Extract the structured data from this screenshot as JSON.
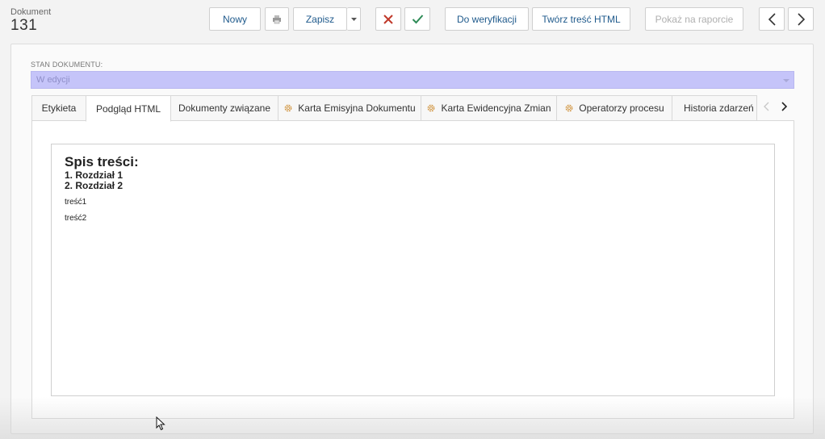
{
  "header": {
    "doc_label": "Dokument",
    "doc_number": "131"
  },
  "toolbar": {
    "new_label": "Nowy",
    "save_label": "Zapisz",
    "verify_label": "Do weryfikacji",
    "create_html_label": "Twórz treść HTML",
    "show_report_label": "Pokaż na raporcie"
  },
  "icons": {
    "print": "print-icon",
    "dropdown": "caret-down-icon",
    "cancel": "x-icon",
    "confirm": "check-icon",
    "prev": "chevron-left-icon",
    "next": "chevron-right-icon",
    "gear": "gear-icon"
  },
  "colors": {
    "cancel": "#c0392b",
    "confirm": "#2e8b57",
    "link": "#1f5a8c",
    "state_bg": "#c5c4f9",
    "gear": "#d39a4a"
  },
  "state": {
    "label": "STAN DOKUMENTU:",
    "value": "W edycji"
  },
  "tabs": [
    {
      "label": "Etykieta"
    },
    {
      "label": "Podgląd HTML",
      "active": true
    },
    {
      "label": "Dokumenty związane"
    },
    {
      "label": "Karta Emisyjna Dokumentu",
      "icon": "gear-icon"
    },
    {
      "label": "Karta Ewidencyjna Zmian",
      "icon": "gear-icon"
    },
    {
      "label": "Operatorzy procesu",
      "icon": "gear-icon"
    },
    {
      "label": "Historia zdarzeń"
    }
  ],
  "preview": {
    "title": "Spis treści:",
    "items": [
      "1. Rozdział 1",
      "2. Rozdział 2"
    ],
    "paragraphs": [
      "treść1",
      "treść2"
    ]
  }
}
